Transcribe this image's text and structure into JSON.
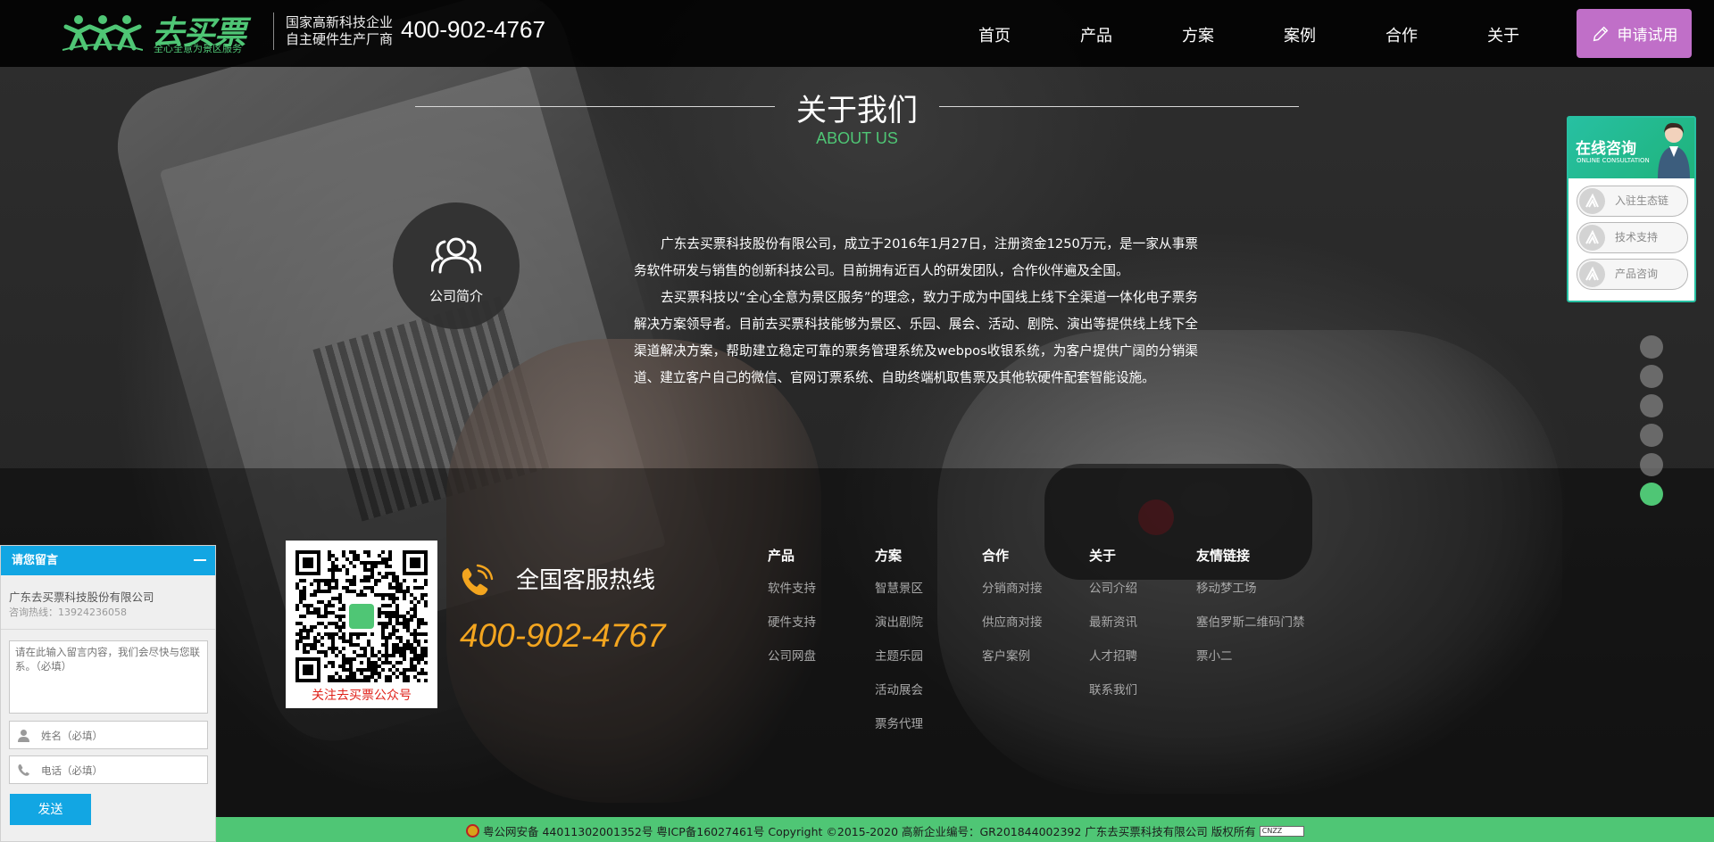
{
  "header": {
    "logo_name": "去买票",
    "logo_slogan": "全心全意为景区服务",
    "sub_line1": "国家高新科技企业",
    "sub_line2": "自主硬件生产厂商",
    "phone": "400-902-4767",
    "nav": [
      "首页",
      "产品",
      "方案",
      "案例",
      "合作",
      "关于"
    ],
    "apply_label": "申请试用"
  },
  "about": {
    "title": "关于我们",
    "subtitle": "ABOUT US",
    "intro_label": "公司简介",
    "paragraph1": "广东去买票科技股份有限公司，成立于2016年1月27日，注册资金1250万元，是一家从事票务软件研发与销售的创新科技公司。目前拥有近百人的研发团队，合作伙伴遍及全国。",
    "paragraph2": "去买票科技以“全心全意为景区服务”的理念，致力于成为中国线上线下全渠道一体化电子票务解决方案领导者。目前去买票科技能够为景区、乐园、展会、活动、剧院、演出等提供线上线下全渠道解决方案，帮助建立稳定可靠的票务管理系统及webpos收银系统，为客户提供广阔的分销渠道、建立客户自己的微信、官网订票系统、自助终端机取售票及其他软硬件配套智能设施。"
  },
  "consult": {
    "title": "在线咨询",
    "subtitle": "ONLINE CONSULTATION",
    "items": [
      "入驻生态链",
      "技术支持",
      "产品咨询"
    ]
  },
  "page_dots": {
    "count": 6,
    "active_index": 5
  },
  "footer": {
    "qr_caption": "关注去买票公众号",
    "hotline_title": "全国客服热线",
    "hotline_number": "400-902-4767",
    "columns": [
      {
        "heading": "产品",
        "links": [
          "软件支持",
          "硬件支持",
          "公司网盘"
        ]
      },
      {
        "heading": "方案",
        "links": [
          "智慧景区",
          "演出剧院",
          "主题乐园",
          "活动展会",
          "票务代理"
        ]
      },
      {
        "heading": "合作",
        "links": [
          "分销商对接",
          "供应商对接",
          "客户案例"
        ]
      },
      {
        "heading": "关于",
        "links": [
          "公司介绍",
          "最新资讯",
          "人才招聘",
          "联系我们"
        ]
      },
      {
        "heading": "友情链接",
        "links": [
          "移动梦工场",
          "塞伯罗斯二维码门禁",
          "票小二"
        ]
      }
    ]
  },
  "message": {
    "title": "请您留言",
    "company": "广东去买票科技股份有限公司",
    "tel": "咨询热线：13924236058",
    "text_placeholder": "请在此输入留言内容，我们会尽快与您联系。（必填）",
    "name_placeholder": "姓名（必填）",
    "phone_placeholder": "电话（必填）",
    "send_label": "发送"
  },
  "bottom_bar": {
    "text": "粤公网安备 44011302001352号 粤ICP备16027461号 Copyright ©2015-2020 高新企业编号：GR201844002392 广东去买票科技有限公司 版权所有",
    "cnzz": "CNZZ"
  },
  "colors": {
    "brand_green": "#4fc675",
    "apply_purple": "#c06fc8",
    "widget_blue": "#12a6e3",
    "hotline_orange": "#f3a51f",
    "consult_teal": "#27c0a2"
  }
}
